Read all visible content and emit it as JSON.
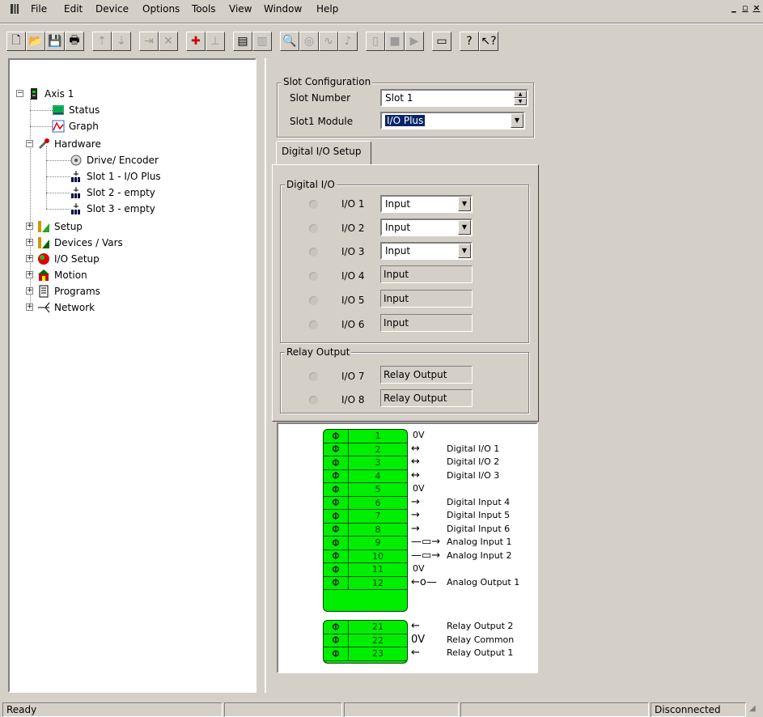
{
  "menu": {
    "items": [
      "File",
      "Edit",
      "Device",
      "Options",
      "Tools",
      "View",
      "Window",
      "Help"
    ],
    "window_buttons": [
      "_",
      "▫",
      "×"
    ]
  },
  "toolbar": {
    "buttons": [
      {
        "icon": "new-document-icon"
      },
      {
        "icon": "open-folder-icon"
      },
      {
        "icon": "save-icon"
      },
      {
        "icon": "print-icon"
      },
      {
        "icon": "upload-icon",
        "disabled": true
      },
      {
        "icon": "download-icon",
        "disabled": true
      },
      {
        "icon": "connect-icon",
        "disabled": true
      },
      {
        "icon": "disconnect-icon",
        "disabled": true
      },
      {
        "icon": "add-axis-icon"
      },
      {
        "icon": "axis-icon",
        "disabled": true
      },
      {
        "icon": "program-icon"
      },
      {
        "icon": "program-list-icon",
        "disabled": true
      },
      {
        "icon": "zoom-icon",
        "disabled": true
      },
      {
        "icon": "target-icon",
        "disabled": true
      },
      {
        "icon": "oscilloscope-icon",
        "disabled": true
      },
      {
        "icon": "tune-icon",
        "disabled": true
      },
      {
        "icon": "stop-icon",
        "disabled": true
      },
      {
        "icon": "run-icon",
        "disabled": true
      },
      {
        "icon": "step-icon",
        "disabled": true
      },
      {
        "icon": "window-icon"
      },
      {
        "icon": "help-icon"
      },
      {
        "icon": "context-help-icon"
      }
    ]
  },
  "tree": {
    "root": "Axis 1",
    "status": "Status",
    "graph": "Graph",
    "hardware": "Hardware",
    "hardware_children": [
      "Drive/ Encoder",
      "Slot 1 - I/O Plus",
      "Slot 2 - empty",
      "Slot 3 - empty"
    ],
    "setup": "Setup",
    "devices": "Devices / Vars",
    "io_setup": "I/O Setup",
    "motion": "Motion",
    "programs": "Programs",
    "network": "Network"
  },
  "slot_config": {
    "title": "Slot Configuration",
    "slot_number_label": "Slot Number",
    "slot_number_value": "Slot 1",
    "module_label": "Slot1 Module",
    "module_value": "I/O Plus"
  },
  "tab": {
    "label": "Digital I/O Setup"
  },
  "digital_io": {
    "title": "Digital I/O",
    "rows": [
      {
        "label": "I/O 1",
        "value": "Input",
        "editable": true
      },
      {
        "label": "I/O 2",
        "value": "Input",
        "editable": true
      },
      {
        "label": "I/O 3",
        "value": "Input",
        "editable": true
      },
      {
        "label": "I/O 4",
        "value": "Input",
        "editable": false
      },
      {
        "label": "I/O 5",
        "value": "Input",
        "editable": false
      },
      {
        "label": "I/O 6",
        "value": "Input",
        "editable": false
      }
    ]
  },
  "relay_output": {
    "title": "Relay Output",
    "rows": [
      {
        "label": "I/O 7",
        "value": "Relay Output"
      },
      {
        "label": "I/O 8",
        "value": "Relay Output"
      }
    ]
  },
  "terminal_block_1": [
    {
      "pin": "1",
      "arrow": "",
      "signal": "0V",
      "inline": true
    },
    {
      "pin": "2",
      "arrow": "↔",
      "signal": "Digital I/O 1"
    },
    {
      "pin": "3",
      "arrow": "↔",
      "signal": "Digital I/O 2"
    },
    {
      "pin": "4",
      "arrow": "↔",
      "signal": "Digital I/O 3"
    },
    {
      "pin": "5",
      "arrow": "",
      "signal": "0V",
      "inline": true
    },
    {
      "pin": "6",
      "arrow": "→",
      "signal": "Digital Input 4"
    },
    {
      "pin": "7",
      "arrow": "→",
      "signal": "Digital Input 5"
    },
    {
      "pin": "8",
      "arrow": "→",
      "signal": "Digital Input 6"
    },
    {
      "pin": "9",
      "arrow": "—▭→",
      "signal": "Analog Input 1"
    },
    {
      "pin": "10",
      "arrow": "—▭→",
      "signal": "Analog Input 2"
    },
    {
      "pin": "11",
      "arrow": "",
      "signal": "0V",
      "inline": true
    },
    {
      "pin": "12",
      "arrow": "←o—",
      "signal": "Analog Output 1"
    }
  ],
  "terminal_block_2": [
    {
      "pin": "21",
      "arrow": "←",
      "signal": "Relay Output 2"
    },
    {
      "pin": "22",
      "arrow": "0V",
      "signal": "Relay Common"
    },
    {
      "pin": "23",
      "arrow": "←",
      "signal": "Relay Output 1"
    }
  ],
  "status_bar": {
    "left": "Ready",
    "right": "Disconnected"
  }
}
